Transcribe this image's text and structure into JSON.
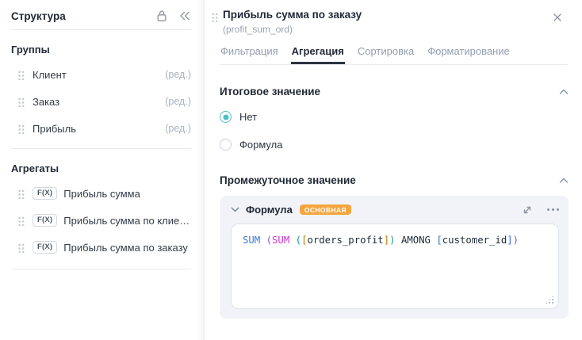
{
  "colors": {
    "accent_teal": "#4cc0c2",
    "badge_orange": "#f5a53f",
    "tab_active_underline": "#2d3341",
    "card_background": "#f1f3f8"
  },
  "icons": {
    "lock": "padlock-outline",
    "collapse_sidebar": "double-chevron-left",
    "drag_handle": "six-dots-grip",
    "close": "x",
    "section_collapse": "chevron-up",
    "formula_collapse": "chevron-down",
    "expand": "diagonal-arrows",
    "menu": "three-dots",
    "resize": "grip-dots-corner"
  },
  "sidebar": {
    "title": "Структура",
    "groups_heading": "Группы",
    "groups": [
      {
        "label": "Клиент",
        "action": "(ред.)"
      },
      {
        "label": "Заказ",
        "action": "(ред.)"
      },
      {
        "label": "Прибыль",
        "action": "(ред.)"
      }
    ],
    "aggregates_heading": "Агрегаты",
    "aggregates": [
      {
        "badge": "F(X)",
        "label": "Прибыль сумма"
      },
      {
        "badge": "F(X)",
        "label": "Прибыль сумма по клие…"
      },
      {
        "badge": "F(X)",
        "label": "Прибыль сумма по заказу"
      }
    ]
  },
  "panel": {
    "title": "Прибыль сумма по заказу",
    "subtitle": "(profit_sum_ord)",
    "tabs": [
      {
        "label": "Фильтрация",
        "active": false
      },
      {
        "label": "Агрегация",
        "active": true
      },
      {
        "label": "Сортировка",
        "active": false
      },
      {
        "label": "Форматирование",
        "active": false
      }
    ],
    "total_section": {
      "title": "Итоговое значение",
      "options": [
        {
          "label": "Нет",
          "selected": true
        },
        {
          "label": "Формула",
          "selected": false
        }
      ]
    },
    "intermediate_section": {
      "title": "Промежуточное значение",
      "formula_label": "Формула",
      "badge": "ОСНОВНАЯ",
      "formula_text": "SUM (SUM ([orders_profit]) AMONG [customer_id])",
      "formula_tokens": [
        {
          "text": "SUM",
          "color": "#3a77d9"
        },
        {
          "text": " ",
          "color": "#1d2a3a"
        },
        {
          "text": "(",
          "color": "#8250df"
        },
        {
          "text": "SUM",
          "color": "#cd32cd"
        },
        {
          "text": " ",
          "color": "#1d2a3a"
        },
        {
          "text": "(",
          "color": "#13998c"
        },
        {
          "text": "[",
          "color": "#c77400"
        },
        {
          "text": "orders_profit",
          "color": "#1d2a3a"
        },
        {
          "text": "]",
          "color": "#c77400"
        },
        {
          "text": ")",
          "color": "#13998c"
        },
        {
          "text": " ",
          "color": "#1d2a3a"
        },
        {
          "text": "AMONG",
          "color": "#1d2a3a"
        },
        {
          "text": " ",
          "color": "#1d2a3a"
        },
        {
          "text": "[",
          "color": "#2f6fd0"
        },
        {
          "text": "customer_id",
          "color": "#1d2a3a"
        },
        {
          "text": "]",
          "color": "#2f6fd0"
        },
        {
          "text": ")",
          "color": "#8250df"
        }
      ]
    }
  }
}
